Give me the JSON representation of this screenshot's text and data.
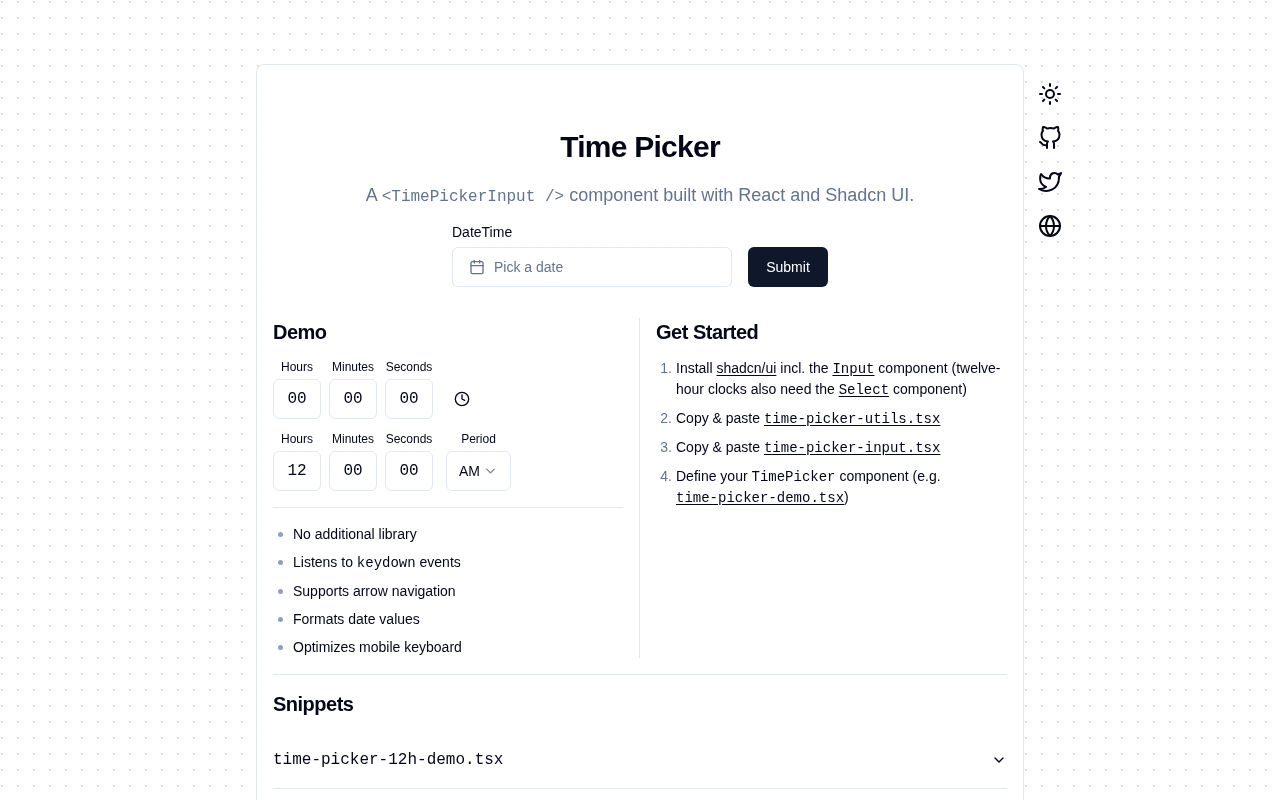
{
  "header": {
    "title": "Time Picker",
    "subtitle": [
      {
        "kind": "text",
        "text": "A "
      },
      {
        "kind": "code",
        "text": "<TimePickerInput />"
      },
      {
        "kind": "text",
        "text": " component built with React and Shadcn UI."
      }
    ]
  },
  "form": {
    "label": "DateTime",
    "date_field": {
      "placeholder": "Pick a date"
    },
    "submit": "Submit"
  },
  "demo": {
    "title": "Demo",
    "pickers": [
      {
        "kind": "clock",
        "fields": [
          {
            "label": "Hours",
            "value": "00"
          },
          {
            "label": "Minutes",
            "value": "00"
          },
          {
            "label": "Seconds",
            "value": "00"
          }
        ]
      },
      {
        "kind": "meridiem",
        "fields": [
          {
            "label": "Hours",
            "value": "12"
          },
          {
            "label": "Minutes",
            "value": "00"
          },
          {
            "label": "Seconds",
            "value": "00"
          }
        ],
        "period": {
          "label": "Period",
          "value": "AM"
        }
      }
    ],
    "features": [
      [
        {
          "kind": "text",
          "text": "No additional library"
        }
      ],
      [
        {
          "kind": "text",
          "text": "Listens to "
        },
        {
          "kind": "code",
          "text": "keydown"
        },
        {
          "kind": "text",
          "text": " events"
        }
      ],
      [
        {
          "kind": "text",
          "text": "Supports arrow navigation"
        }
      ],
      [
        {
          "kind": "text",
          "text": "Formats date values"
        }
      ],
      [
        {
          "kind": "text",
          "text": "Optimizes mobile keyboard"
        }
      ]
    ]
  },
  "get_started": {
    "title": "Get Started",
    "steps": [
      {
        "number": "1.",
        "parts": [
          {
            "kind": "text",
            "text": "Install "
          },
          {
            "kind": "link",
            "text": "shadcn/ui"
          },
          {
            "kind": "text",
            "text": " incl. the "
          },
          {
            "kind": "code_link",
            "text": "Input"
          },
          {
            "kind": "text",
            "text": " component (twelve-hour clocks also need the "
          },
          {
            "kind": "code_link",
            "text": "Select"
          },
          {
            "kind": "text",
            "text": " component)"
          }
        ]
      },
      {
        "number": "2.",
        "parts": [
          {
            "kind": "text",
            "text": "Copy & paste "
          },
          {
            "kind": "code_link",
            "text": "time-picker-utils.tsx"
          }
        ]
      },
      {
        "number": "3.",
        "parts": [
          {
            "kind": "text",
            "text": "Copy & paste "
          },
          {
            "kind": "code_link",
            "text": "time-picker-input.tsx"
          }
        ]
      },
      {
        "number": "4.",
        "parts": [
          {
            "kind": "text",
            "text": "Define your "
          },
          {
            "kind": "code",
            "text": "TimePicker"
          },
          {
            "kind": "text",
            "text": " component (e.g. "
          },
          {
            "kind": "code_link",
            "text": "time-picker-demo.tsx"
          },
          {
            "kind": "text",
            "text": ")"
          }
        ]
      }
    ]
  },
  "snippets": {
    "title": "Snippets",
    "items": [
      {
        "label": "time-picker-12h-demo.tsx",
        "expanded": false
      }
    ]
  }
}
